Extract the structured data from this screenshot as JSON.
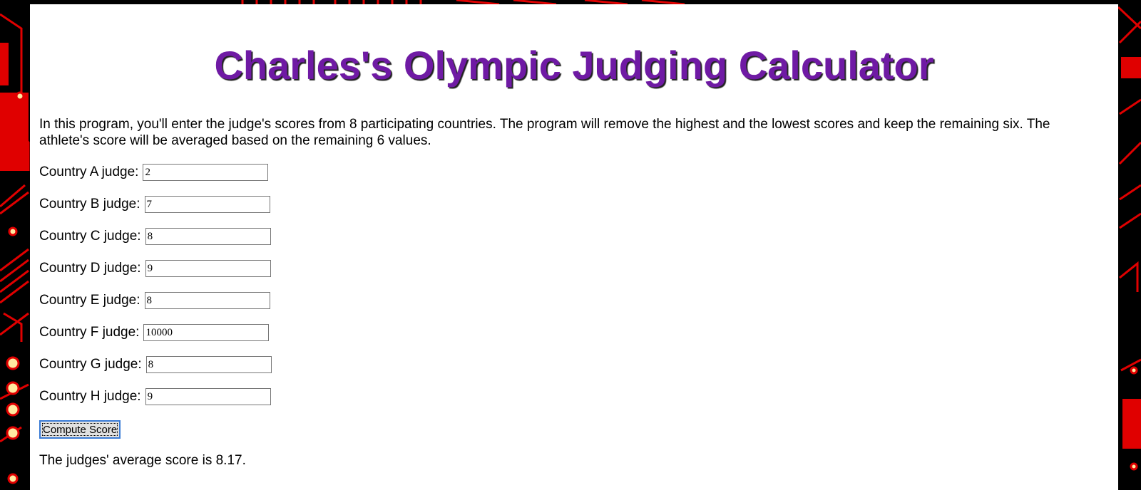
{
  "page": {
    "title": "Charles's Olympic Judging Calculator",
    "intro": "In this program, you'll enter the judge's scores from 8 participating countries. The program will remove the highest and the lowest scores and keep the remaining six. The athlete's score will be averaged based on the remaining 6 values."
  },
  "judges": [
    {
      "label": "Country A judge:",
      "value": "2"
    },
    {
      "label": "Country B judge:",
      "value": "7"
    },
    {
      "label": "Country C judge:",
      "value": "8"
    },
    {
      "label": "Country D judge:",
      "value": "9"
    },
    {
      "label": "Country E judge:",
      "value": "8"
    },
    {
      "label": "Country F judge:",
      "value": "10000"
    },
    {
      "label": "Country G judge:",
      "value": "8"
    },
    {
      "label": "Country H judge:",
      "value": "9"
    }
  ],
  "compute_button": {
    "label": "Compute Score"
  },
  "result": {
    "text": "The judges' average score is 8.17."
  },
  "colors": {
    "title": "#6f1aa4",
    "background": "#000000",
    "circuit": "#e00000"
  }
}
